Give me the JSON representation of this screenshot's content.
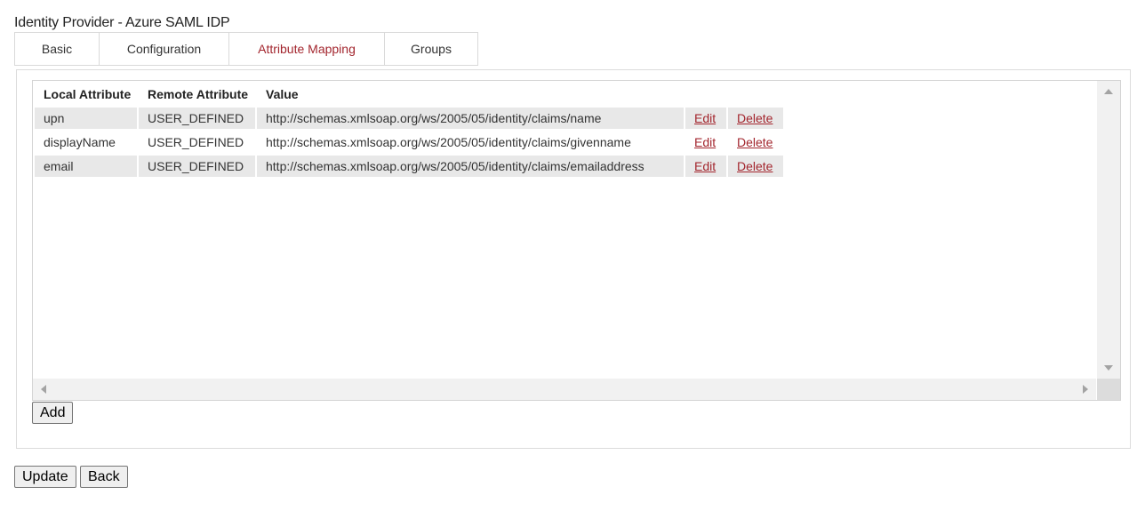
{
  "page": {
    "title": "Identity Provider - Azure SAML IDP"
  },
  "tabs": [
    {
      "label": "Basic",
      "active": false
    },
    {
      "label": "Configuration",
      "active": false
    },
    {
      "label": "Attribute Mapping",
      "active": true
    },
    {
      "label": "Groups",
      "active": false
    }
  ],
  "grid": {
    "columns": [
      "Local Attribute",
      "Remote Attribute",
      "Value"
    ],
    "rows": [
      {
        "local": "upn",
        "remote": "USER_DEFINED",
        "value": "http://schemas.xmlsoap.org/ws/2005/05/identity/claims/name",
        "edit": "Edit",
        "delete": "Delete"
      },
      {
        "local": "displayName",
        "remote": "USER_DEFINED",
        "value": "http://schemas.xmlsoap.org/ws/2005/05/identity/claims/givenname",
        "edit": "Edit",
        "delete": "Delete"
      },
      {
        "local": "email",
        "remote": "USER_DEFINED",
        "value": "http://schemas.xmlsoap.org/ws/2005/05/identity/claims/emailaddress",
        "edit": "Edit",
        "delete": "Delete"
      }
    ]
  },
  "buttons": {
    "add": "Add",
    "update": "Update",
    "back": "Back"
  },
  "colors": {
    "accent": "#a3262e",
    "row_shade": "#e8e8e8",
    "scrollbar": "#f1f1f1"
  },
  "icons": {
    "scroll_up": "triangle-up",
    "scroll_down": "triangle-down",
    "scroll_left": "triangle-left",
    "scroll_right": "triangle-right"
  }
}
